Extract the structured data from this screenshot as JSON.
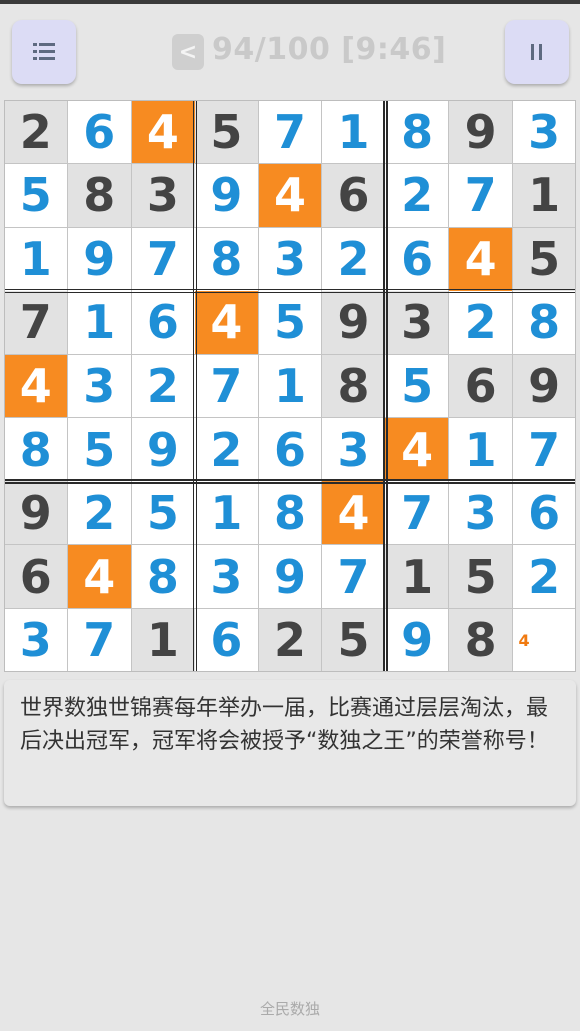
{
  "toolbar": {
    "menu_icon": "menu-list-icon",
    "pause_icon": "pause-icon",
    "back_label": "<",
    "status_text": "94/100 [9:46]"
  },
  "colors": {
    "given_bg": "#e2e2e2",
    "given_text": "#444444",
    "filled_text": "#1f8fd6",
    "highlight_bg": "#f78b21",
    "note_text": "#f07a10"
  },
  "board": {
    "highlight_digit": "4",
    "rows": [
      [
        {
          "v": "2",
          "t": "given"
        },
        {
          "v": "6",
          "t": "filled"
        },
        {
          "v": "4",
          "t": "filled"
        },
        {
          "v": "5",
          "t": "given"
        },
        {
          "v": "7",
          "t": "filled"
        },
        {
          "v": "1",
          "t": "filled"
        },
        {
          "v": "8",
          "t": "filled"
        },
        {
          "v": "9",
          "t": "given"
        },
        {
          "v": "3",
          "t": "filled"
        }
      ],
      [
        {
          "v": "5",
          "t": "filled"
        },
        {
          "v": "8",
          "t": "given"
        },
        {
          "v": "3",
          "t": "given"
        },
        {
          "v": "9",
          "t": "filled"
        },
        {
          "v": "4",
          "t": "filled"
        },
        {
          "v": "6",
          "t": "given"
        },
        {
          "v": "2",
          "t": "filled"
        },
        {
          "v": "7",
          "t": "filled"
        },
        {
          "v": "1",
          "t": "given"
        }
      ],
      [
        {
          "v": "1",
          "t": "filled"
        },
        {
          "v": "9",
          "t": "filled"
        },
        {
          "v": "7",
          "t": "filled"
        },
        {
          "v": "8",
          "t": "filled"
        },
        {
          "v": "3",
          "t": "filled"
        },
        {
          "v": "2",
          "t": "filled"
        },
        {
          "v": "6",
          "t": "filled"
        },
        {
          "v": "4",
          "t": "filled"
        },
        {
          "v": "5",
          "t": "given"
        }
      ],
      [
        {
          "v": "7",
          "t": "given"
        },
        {
          "v": "1",
          "t": "filled"
        },
        {
          "v": "6",
          "t": "filled"
        },
        {
          "v": "4",
          "t": "filled"
        },
        {
          "v": "5",
          "t": "filled"
        },
        {
          "v": "9",
          "t": "given"
        },
        {
          "v": "3",
          "t": "given"
        },
        {
          "v": "2",
          "t": "filled"
        },
        {
          "v": "8",
          "t": "filled"
        }
      ],
      [
        {
          "v": "4",
          "t": "filled"
        },
        {
          "v": "3",
          "t": "filled"
        },
        {
          "v": "2",
          "t": "filled"
        },
        {
          "v": "7",
          "t": "filled"
        },
        {
          "v": "1",
          "t": "filled"
        },
        {
          "v": "8",
          "t": "given"
        },
        {
          "v": "5",
          "t": "filled"
        },
        {
          "v": "6",
          "t": "given"
        },
        {
          "v": "9",
          "t": "given"
        }
      ],
      [
        {
          "v": "8",
          "t": "filled"
        },
        {
          "v": "5",
          "t": "filled"
        },
        {
          "v": "9",
          "t": "filled"
        },
        {
          "v": "2",
          "t": "filled"
        },
        {
          "v": "6",
          "t": "filled"
        },
        {
          "v": "3",
          "t": "filled"
        },
        {
          "v": "4",
          "t": "filled"
        },
        {
          "v": "1",
          "t": "filled"
        },
        {
          "v": "7",
          "t": "filled"
        }
      ],
      [
        {
          "v": "9",
          "t": "given"
        },
        {
          "v": "2",
          "t": "filled"
        },
        {
          "v": "5",
          "t": "filled"
        },
        {
          "v": "1",
          "t": "filled"
        },
        {
          "v": "8",
          "t": "filled"
        },
        {
          "v": "4",
          "t": "filled"
        },
        {
          "v": "7",
          "t": "filled"
        },
        {
          "v": "3",
          "t": "filled"
        },
        {
          "v": "6",
          "t": "filled"
        }
      ],
      [
        {
          "v": "6",
          "t": "given"
        },
        {
          "v": "4",
          "t": "filled"
        },
        {
          "v": "8",
          "t": "filled"
        },
        {
          "v": "3",
          "t": "filled"
        },
        {
          "v": "9",
          "t": "filled"
        },
        {
          "v": "7",
          "t": "filled"
        },
        {
          "v": "1",
          "t": "given"
        },
        {
          "v": "5",
          "t": "given"
        },
        {
          "v": "2",
          "t": "filled"
        }
      ],
      [
        {
          "v": "3",
          "t": "filled"
        },
        {
          "v": "7",
          "t": "filled"
        },
        {
          "v": "1",
          "t": "given"
        },
        {
          "v": "6",
          "t": "filled"
        },
        {
          "v": "2",
          "t": "given"
        },
        {
          "v": "5",
          "t": "given"
        },
        {
          "v": "9",
          "t": "filled"
        },
        {
          "v": "8",
          "t": "given"
        },
        {
          "v": "4",
          "t": "note"
        }
      ]
    ]
  },
  "tip_text": "世界数独世锦赛每年举办一届，比赛通过层层淘汰，最后决出冠军，冠军将会被授予“数独之王”的荣誉称号！",
  "footer_text": "全民数独"
}
